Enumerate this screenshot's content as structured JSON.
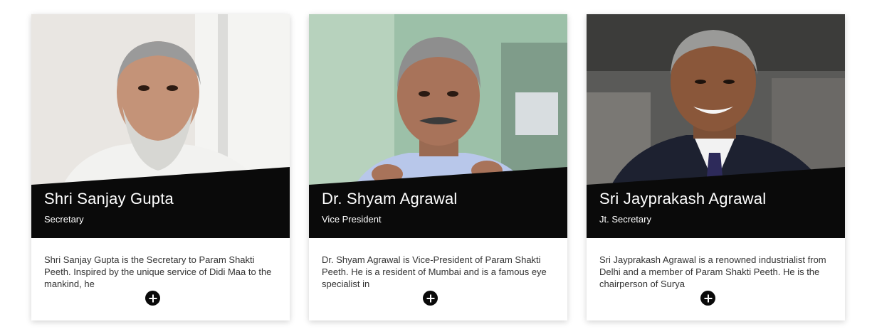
{
  "colors": {
    "band": "#0a0a0a",
    "name_text": "#ffffff",
    "bio_text": "#333333",
    "button": "#0a0a0a"
  },
  "cards": [
    {
      "photo_icon": "portrait-photo",
      "name": "Shri Sanjay Gupta",
      "role": "Secretary",
      "bio": "Shri Sanjay Gupta is the Secretary to Param Shakti Peeth. Inspired by the unique service of Didi Maa to the mankind, he",
      "button_icon": "plus-icon"
    },
    {
      "photo_icon": "portrait-photo",
      "name": "Dr. Shyam Agrawal",
      "role": "Vice President",
      "bio": "Dr. Shyam Agrawal is Vice-President of Param Shakti Peeth. He is a resident of Mumbai and is a famous eye specialist in",
      "button_icon": "plus-icon"
    },
    {
      "photo_icon": "portrait-photo",
      "name": "Sri Jayprakash Agrawal",
      "role": "Jt. Secretary",
      "bio": "Sri Jayprakash Agrawal is a renowned industrialist from Delhi and a member of Param Shakti Peeth. He is the chairperson of Surya",
      "button_icon": "plus-icon"
    }
  ]
}
